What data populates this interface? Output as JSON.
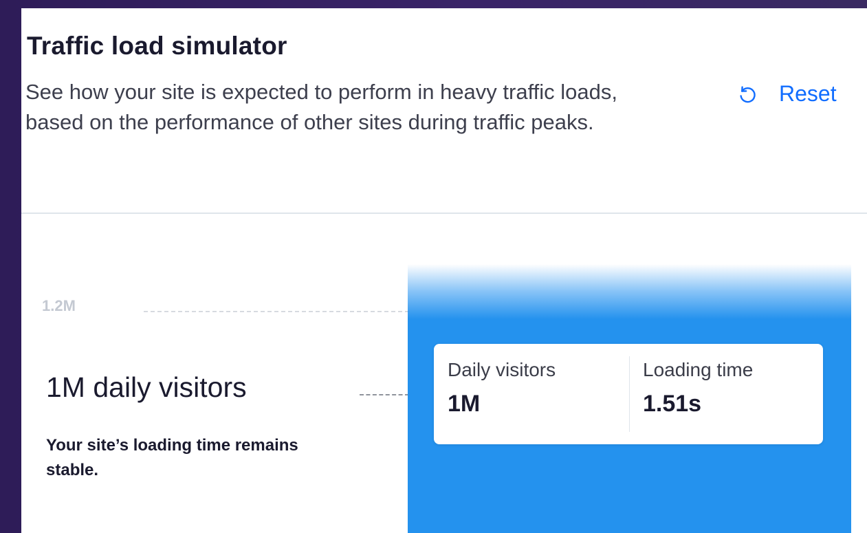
{
  "header": {
    "title": "Traffic load simulator",
    "subtitle": "See how your site is expected to perform in heavy traffic loads, based on the performance of other sites during traffic peaks.",
    "reset_label": "Reset",
    "reset_icon": "reset-icon"
  },
  "simulator": {
    "tick_label": "1.2M",
    "visitors_heading": "1M daily visitors",
    "status_text": "Your site’s loading time remains stable.",
    "metrics": [
      {
        "label": "Daily visitors",
        "value": "1M"
      },
      {
        "label": "Loading time",
        "value": "1.51s"
      }
    ]
  },
  "colors": {
    "accent": "#116dff",
    "graph_fill": "#2492ee",
    "background": "#2e1c58"
  }
}
